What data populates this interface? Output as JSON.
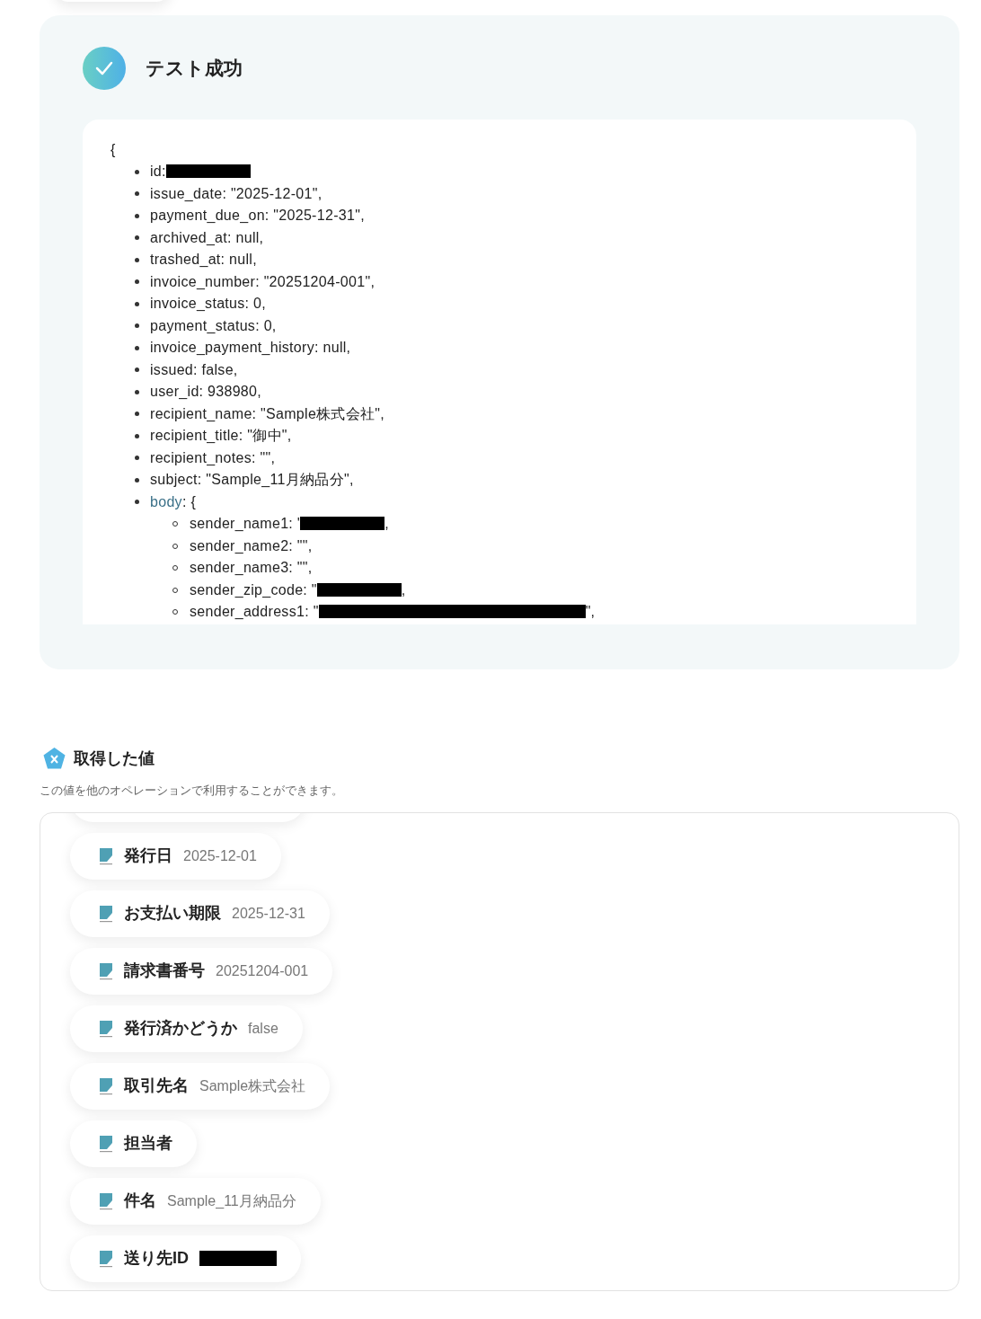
{
  "result": {
    "title": "テスト成功",
    "code": {
      "open": "{",
      "lines": [
        {
          "text": "id:",
          "redacted": true
        },
        {
          "text": "issue_date: \"2025-12-01\","
        },
        {
          "text": "payment_due_on: \"2025-12-31\","
        },
        {
          "text": "archived_at: null,"
        },
        {
          "text": "trashed_at: null,"
        },
        {
          "text": "invoice_number: \"20251204-001\","
        },
        {
          "text": "invoice_status: 0,"
        },
        {
          "text": "payment_status: 0,"
        },
        {
          "text": "invoice_payment_history: null,"
        },
        {
          "text": "issued: false,"
        },
        {
          "text": "user_id: 938980,"
        },
        {
          "text": "recipient_name: \"Sample株式会社\","
        },
        {
          "text": "recipient_title: \"御中\","
        },
        {
          "text": "recipient_notes: \"\","
        },
        {
          "text": "subject: \"Sample_11月納品分\","
        },
        {
          "key": "body",
          "text": ": {",
          "children": [
            {
              "text": "sender_name1: '",
              "redacted": true,
              "after": ","
            },
            {
              "text": "sender_name2: \"\","
            },
            {
              "text": "sender_name3: \"\","
            },
            {
              "text": "sender_zip_code: \"",
              "redacted": true,
              "after": ","
            },
            {
              "text": "sender_address1: \"",
              "redacted": true,
              "after": "\","
            }
          ]
        }
      ]
    }
  },
  "values": {
    "title": "取得した値",
    "description": "この値を他のオペレーションで利用することができます。",
    "items": [
      {
        "label": "発行日",
        "value": "2025-12-01"
      },
      {
        "label": "お支払い期限",
        "value": "2025-12-31"
      },
      {
        "label": "請求書番号",
        "value": "20251204-001"
      },
      {
        "label": "発行済かどうか",
        "value": "false"
      },
      {
        "label": "取引先名",
        "value": "Sample株式会社"
      },
      {
        "label": "担当者"
      },
      {
        "label": "件名",
        "value": "Sample_11月納品分"
      },
      {
        "label": "送り先ID",
        "redacted": true
      }
    ]
  }
}
